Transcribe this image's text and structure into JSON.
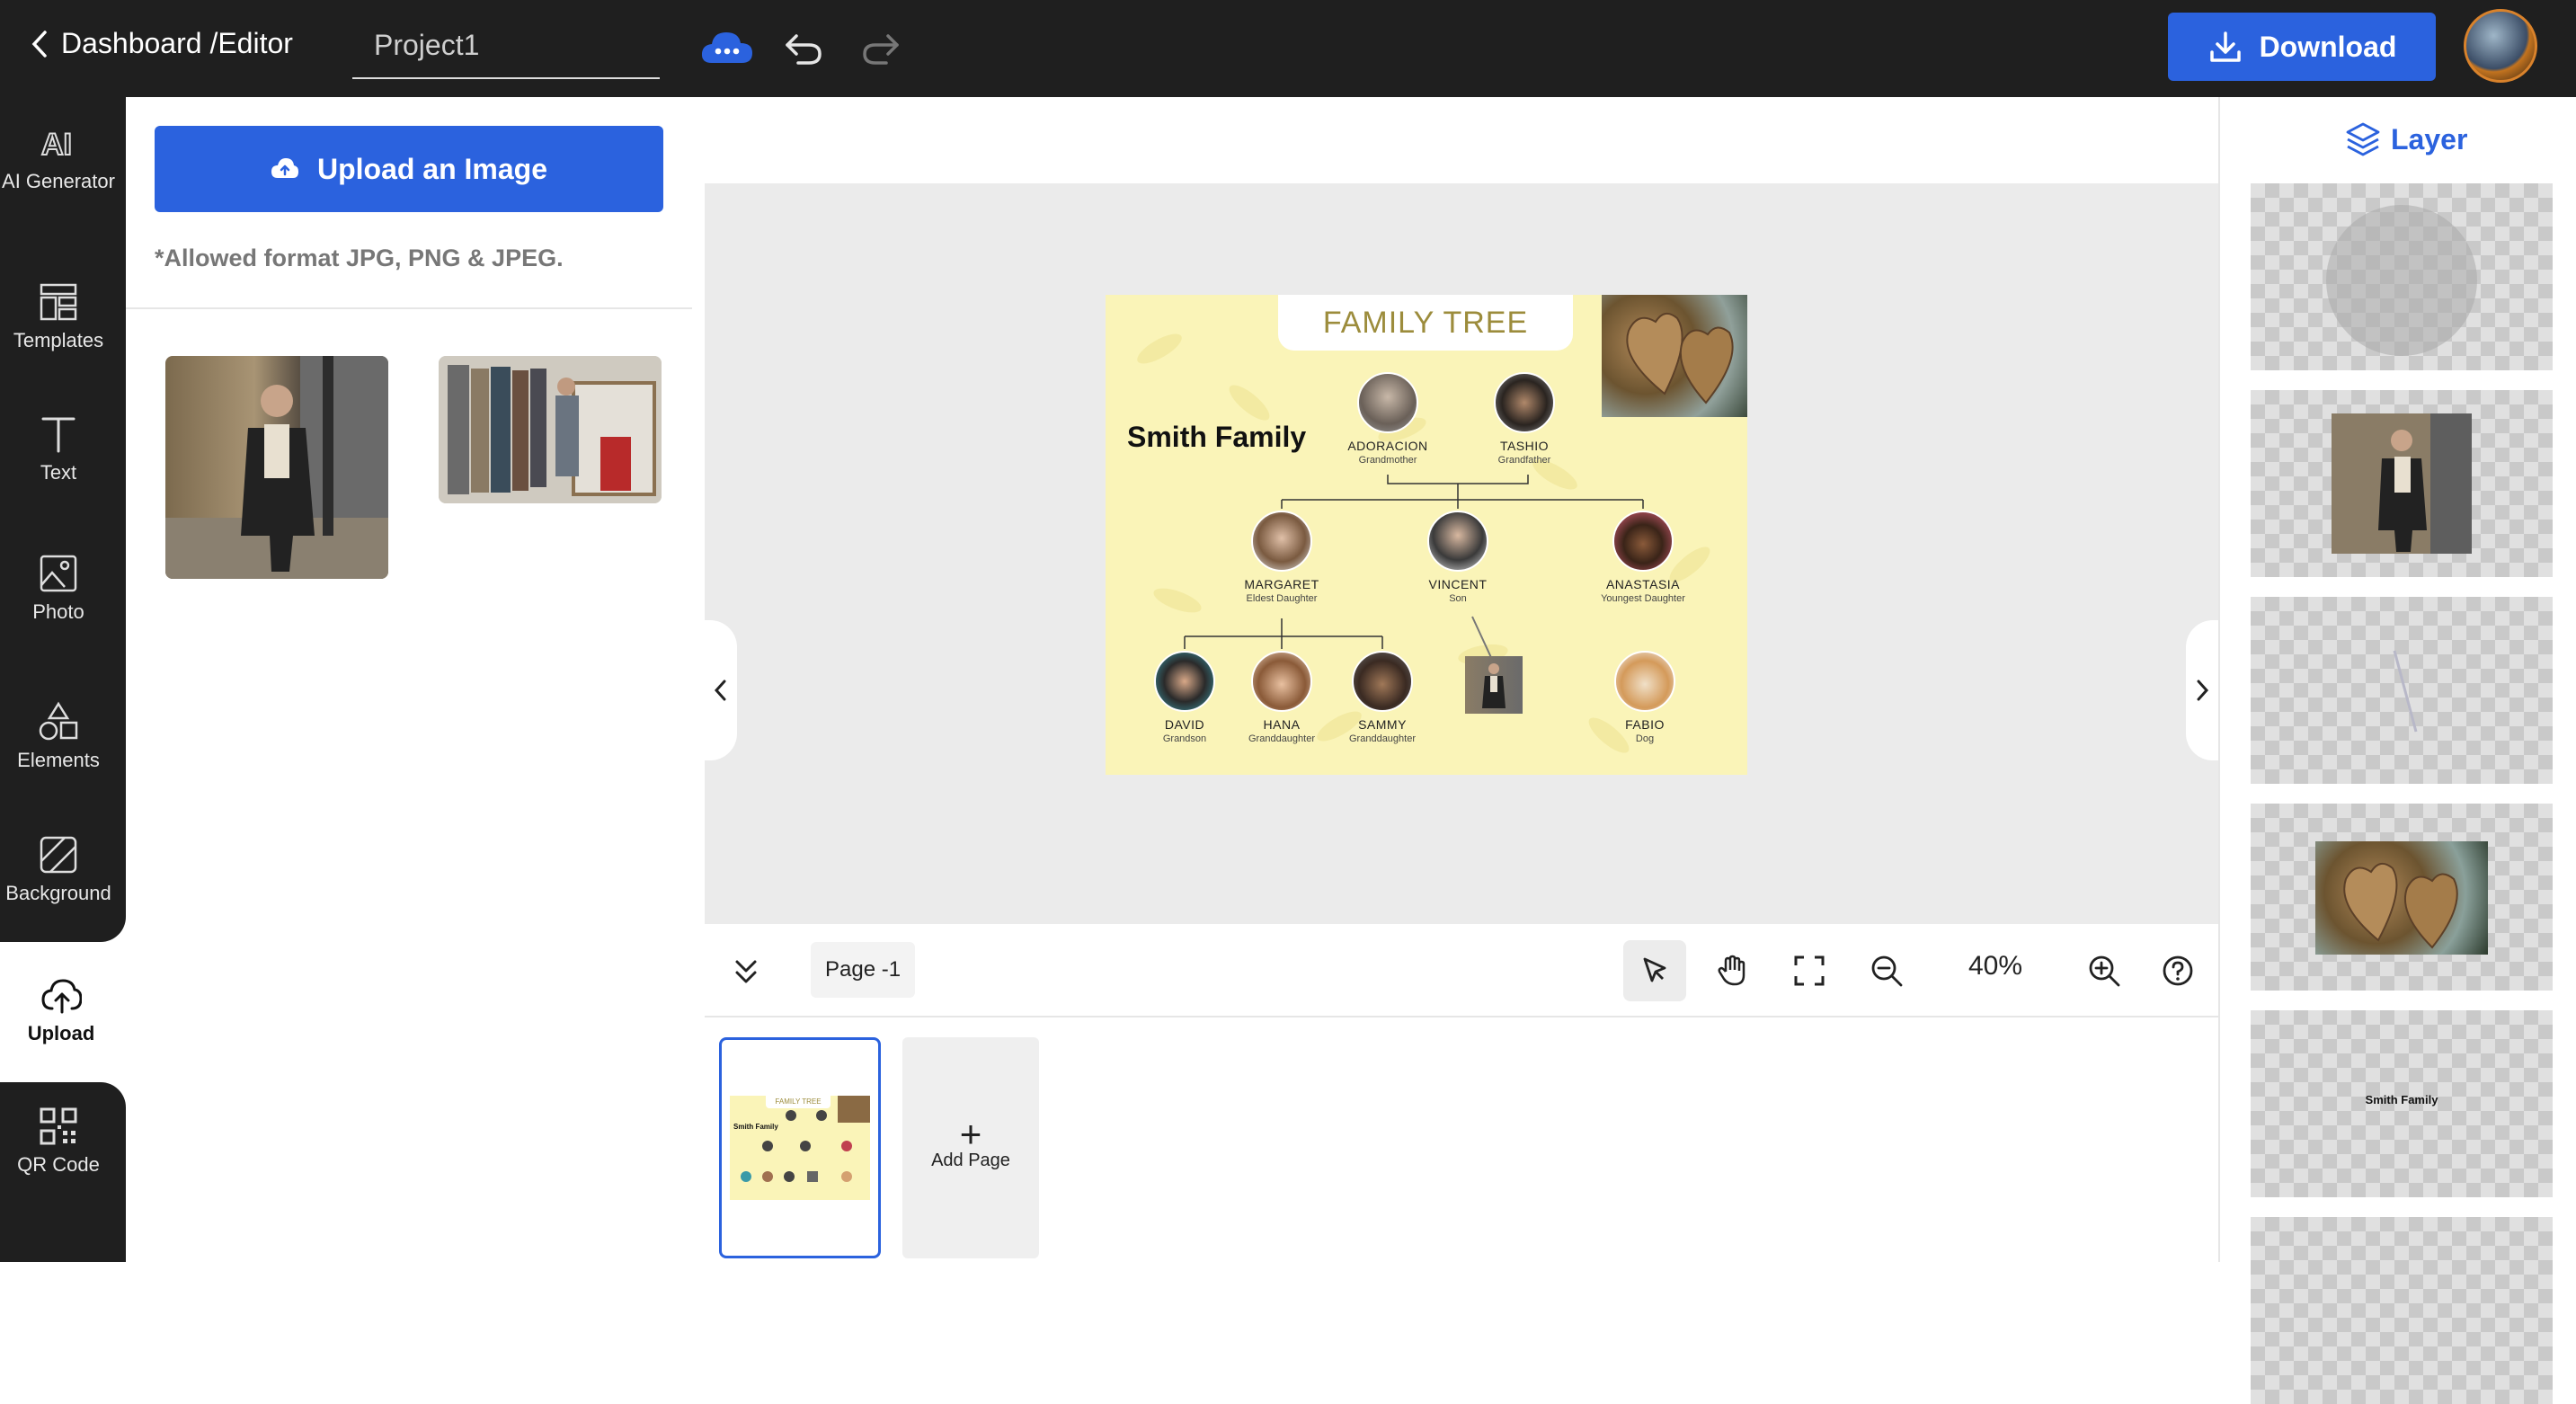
{
  "topbar": {
    "breadcrumb": "Dashboard /Editor",
    "project_name": "Project1",
    "download_label": "Download"
  },
  "nav": [
    {
      "label": "AI Generator",
      "icon": "ai-icon"
    },
    {
      "label": "Templates",
      "icon": "templates-icon"
    },
    {
      "label": "Text",
      "icon": "text-icon"
    },
    {
      "label": "Photo",
      "icon": "photo-icon"
    },
    {
      "label": "Elements",
      "icon": "elements-icon"
    },
    {
      "label": "Background",
      "icon": "background-icon"
    },
    {
      "label": "Upload",
      "icon": "upload-icon",
      "active": true
    },
    {
      "label": "QR Code",
      "icon": "qr-code-icon"
    }
  ],
  "upload_panel": {
    "button_label": "Upload an Image",
    "allowed_text": "*Allowed format JPG, PNG & JPEG."
  },
  "design": {
    "title": "FAMILY TREE",
    "family_name": "Smith Family",
    "members": [
      {
        "name": "ADORACION",
        "role": "Grandmother"
      },
      {
        "name": "TASHIO",
        "role": "Grandfather"
      },
      {
        "name": "MARGARET",
        "role": "Eldest Daughter"
      },
      {
        "name": "VINCENT",
        "role": "Son"
      },
      {
        "name": "ANASTASIA",
        "role": "Youngest Daughter"
      },
      {
        "name": "DAVID",
        "role": "Grandson"
      },
      {
        "name": "HANA",
        "role": "Granddaughter"
      },
      {
        "name": "SAMMY",
        "role": "Granddaughter"
      },
      {
        "name": "FABIO",
        "role": "Dog"
      }
    ]
  },
  "bottombar": {
    "page_label": "Page -1",
    "zoom": "40%"
  },
  "pages": {
    "add_label": "Add Page",
    "thumb_title": "FAMILY TREE",
    "thumb_family": "Smith Family"
  },
  "layers": {
    "title": "Layer",
    "text_layer": "Smith Family"
  },
  "colors": {
    "accent": "#2b62de",
    "dark": "#1f1f1f",
    "canvas_bg": "#faf4b8"
  }
}
